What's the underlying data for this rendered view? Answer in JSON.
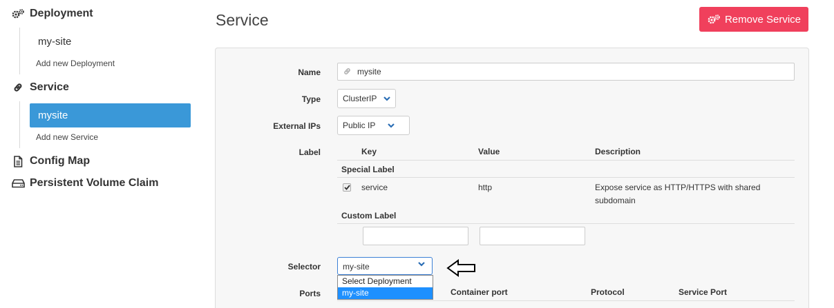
{
  "sidebar": {
    "deployment": {
      "title": "Deployment",
      "items": [
        "my-site"
      ],
      "add_label": "Add new Deployment"
    },
    "service": {
      "title": "Service",
      "items": [
        "mysite"
      ],
      "add_label": "Add new Service"
    },
    "config_map": {
      "title": "Config Map"
    },
    "pvc": {
      "title": "Persistent Volume Claim"
    }
  },
  "header": {
    "title": "Service",
    "remove_label": "Remove Service"
  },
  "form": {
    "name": {
      "label": "Name",
      "value": "mysite"
    },
    "type": {
      "label": "Type",
      "value": "ClusterIP"
    },
    "external_ips": {
      "label": "External IPs",
      "value": "Public IP"
    },
    "label": {
      "label": "Label",
      "columns": [
        "Key",
        "Value",
        "Description"
      ],
      "special_heading": "Special Label",
      "special_row": {
        "checked": true,
        "key": "service",
        "value": "http",
        "description_line1": "Expose service as HTTP/HTTPS with shared",
        "description_line2": "subdomain"
      },
      "custom_heading": "Custom Label"
    },
    "selector": {
      "label": "Selector",
      "value": "my-site",
      "options": [
        "Select Deployment",
        "my-site"
      ],
      "highlighted": "my-site"
    },
    "ports": {
      "label": "Ports",
      "columns": [
        "Container port",
        "Protocol",
        "Service Port"
      ]
    }
  },
  "colors": {
    "accent": "#3a98d8",
    "danger": "#f0405c",
    "dropdown_highlight": "#1e90ff"
  }
}
